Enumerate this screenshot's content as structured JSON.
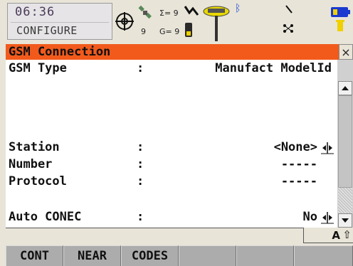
{
  "status": {
    "time": "06:36",
    "mode": "CONFIGURE",
    "sat_count": "9",
    "sigma_label": "Σ= 9",
    "g_label": "G= 9"
  },
  "dialog": {
    "title": "GSM Connection",
    "close_glyph": "×"
  },
  "fields": {
    "gsm_type": {
      "label": "GSM Type",
      "colon": ":",
      "value": "Manufact ModelId"
    },
    "station": {
      "label": "Station",
      "colon": ":",
      "value": "<None>"
    },
    "number": {
      "label": "Number",
      "colon": ":",
      "value": "-----"
    },
    "protocol": {
      "label": "Protocol",
      "colon": ":",
      "value": "-----"
    },
    "auto_conec": {
      "label": "Auto CONEC",
      "colon": ":",
      "value": "No"
    }
  },
  "input_indicator": {
    "caps": "A",
    "shift": "⇧"
  },
  "function_keys": [
    "CONT",
    "NEAR",
    "CODES",
    "",
    "",
    ""
  ],
  "colors": {
    "title_bar": "#f25a1c",
    "background": "#e8e4d8",
    "content": "#ffffff"
  }
}
